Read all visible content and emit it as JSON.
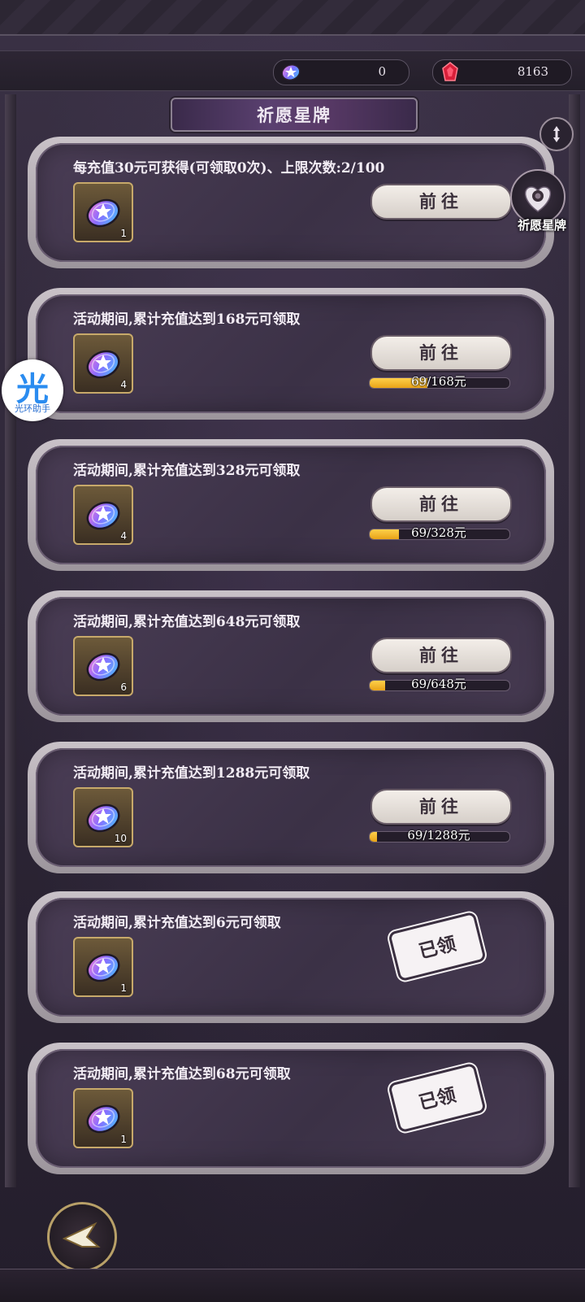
{
  "currencies": [
    {
      "name": "star-card-currency",
      "value": "0"
    },
    {
      "name": "red-gem-currency",
      "value": "8163"
    }
  ],
  "page_title": "祈愿星牌",
  "side_shortcut": {
    "label": "祈愿星牌"
  },
  "helper": {
    "glyph": "光",
    "label": "光环助手"
  },
  "colors": {
    "progress_fill": "#f0b020",
    "button_bg": "#ece6e1",
    "frame": "#c9c2c8",
    "panel": "#3f3449"
  },
  "cards": [
    {
      "title": "每充值30元可获得(可领取0次)、上限次数:2/100",
      "count": "1",
      "action": "前往",
      "state": "goto"
    },
    {
      "title": "活动期间,累计充值达到168元可领取",
      "count": "4",
      "action": "前往",
      "state": "goto",
      "progress_text": "69/168元",
      "progress": 0.41
    },
    {
      "title": "活动期间,累计充值达到328元可领取",
      "count": "4",
      "action": "前往",
      "state": "goto",
      "progress_text": "69/328元",
      "progress": 0.21
    },
    {
      "title": "活动期间,累计充值达到648元可领取",
      "count": "6",
      "action": "前往",
      "state": "goto",
      "progress_text": "69/648元",
      "progress": 0.11
    },
    {
      "title": "活动期间,累计充值达到1288元可领取",
      "count": "10",
      "action": "前往",
      "state": "goto",
      "progress_text": "69/1288元",
      "progress": 0.05
    },
    {
      "title": "活动期间,累计充值达到6元可领取",
      "count": "1",
      "action": "已领",
      "state": "claimed"
    },
    {
      "title": "活动期间,累计充值达到68元可领取",
      "count": "1",
      "action": "已领",
      "state": "claimed"
    }
  ]
}
